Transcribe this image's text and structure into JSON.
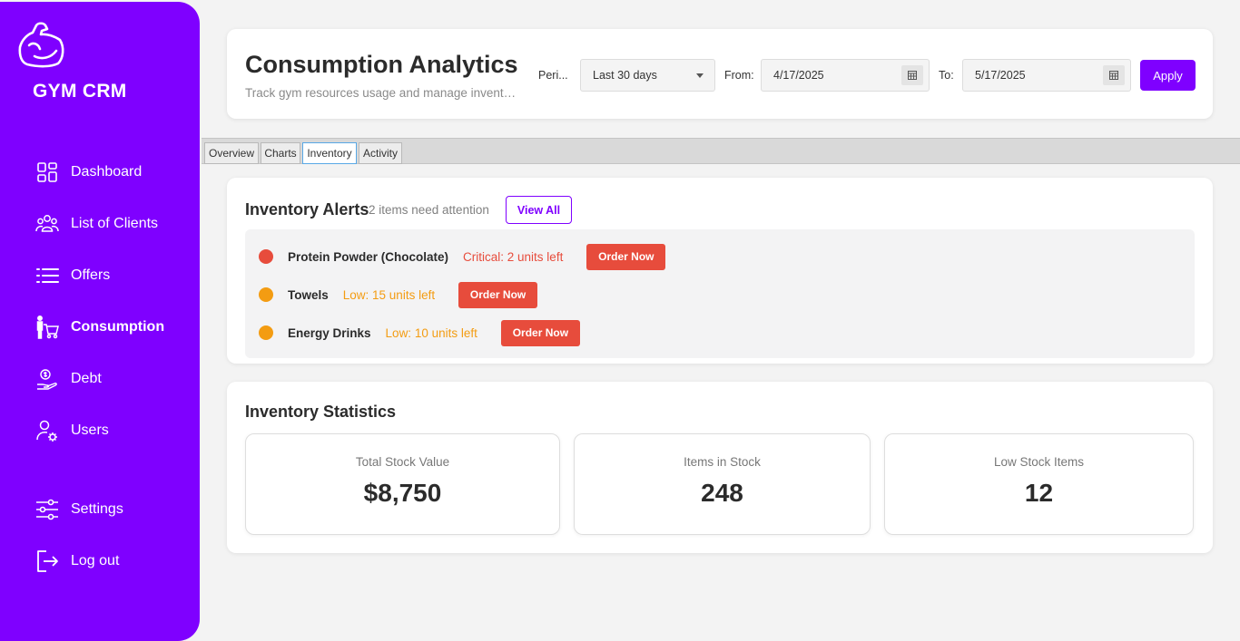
{
  "sidebar": {
    "brand": "GYM CRM",
    "items": [
      {
        "label": "Dashboard"
      },
      {
        "label": "List of Clients"
      },
      {
        "label": "Offers"
      },
      {
        "label": "Consumption"
      },
      {
        "label": "Debt"
      },
      {
        "label": "Users"
      },
      {
        "label": "Settings"
      },
      {
        "label": "Log out"
      }
    ],
    "active_item": "Consumption"
  },
  "header": {
    "title": "Consumption Analytics",
    "subtitle": "Track gym resources usage and manage inventory",
    "period_label": "Peri...",
    "period_value": "Last 30 days",
    "from_label": "From:",
    "from_value": "4/17/2025",
    "to_label": "To:",
    "to_value": "5/17/2025",
    "apply_label": "Apply"
  },
  "tabs": [
    {
      "label": "Overview"
    },
    {
      "label": "Charts"
    },
    {
      "label": "Inventory"
    },
    {
      "label": "Activity"
    }
  ],
  "active_tab": "Inventory",
  "alerts": {
    "title": "Inventory Alerts",
    "count_text": "2 items need attention",
    "view_all_label": "View All",
    "items": [
      {
        "name": "Protein Powder (Chocolate)",
        "status": "Critical: 2 units left",
        "button": "Order Now",
        "status_color": "#e74c3c"
      },
      {
        "name": "Towels",
        "status": "Low: 15 units left",
        "button": "Order Now",
        "status_color": "#f39c12"
      },
      {
        "name": "Energy Drinks",
        "status": "Low: 10 units left",
        "button": "Order Now",
        "status_color": "#f39c12"
      }
    ]
  },
  "stats": {
    "title": "Inventory Statistics",
    "items": [
      {
        "label": "Total Stock Value",
        "value": "$8,750"
      },
      {
        "label": "Items in Stock",
        "value": "248"
      },
      {
        "label": "Low Stock Items",
        "value": "12"
      }
    ]
  },
  "colors": {
    "brand": "#7f00ff",
    "critical": "#e74c3c",
    "warning": "#f39c12"
  }
}
